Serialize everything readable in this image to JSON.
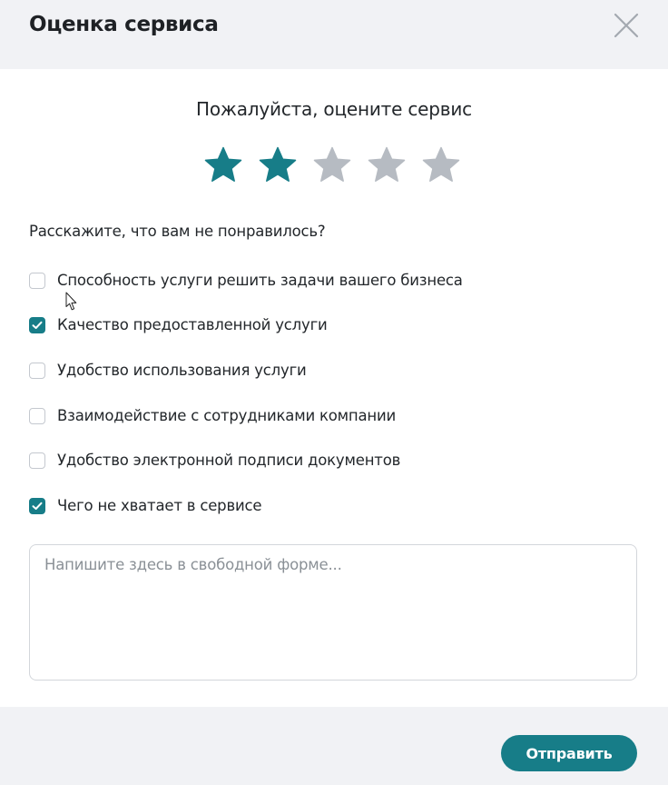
{
  "dialog": {
    "title": "Оценка сервиса",
    "close_icon": "close-icon"
  },
  "rating": {
    "prompt": "Пожалуйста, оцените сервис",
    "value": 2,
    "max": 5,
    "active_color": "#177d88",
    "inactive_color": "#b6bbc2"
  },
  "feedback": {
    "question": "Расскажите, что вам не понравилось?",
    "options": [
      {
        "label": "Способность услуги решить задачи вашего бизнеса",
        "checked": false
      },
      {
        "label": "Качество предоставленной услуги",
        "checked": true
      },
      {
        "label": "Удобство использования услуги",
        "checked": false
      },
      {
        "label": "Взаимодействие с сотрудниками компании",
        "checked": false
      },
      {
        "label": "Удобство электронной подписи документов",
        "checked": false
      },
      {
        "label": "Чего не хватает в сервисе",
        "checked": true
      }
    ],
    "comment": {
      "value": "",
      "placeholder": "Напишите здесь в свободной форме..."
    }
  },
  "footer": {
    "submit_label": "Отправить"
  },
  "colors": {
    "accent": "#177d88",
    "header_bg": "#f1f2f5"
  }
}
